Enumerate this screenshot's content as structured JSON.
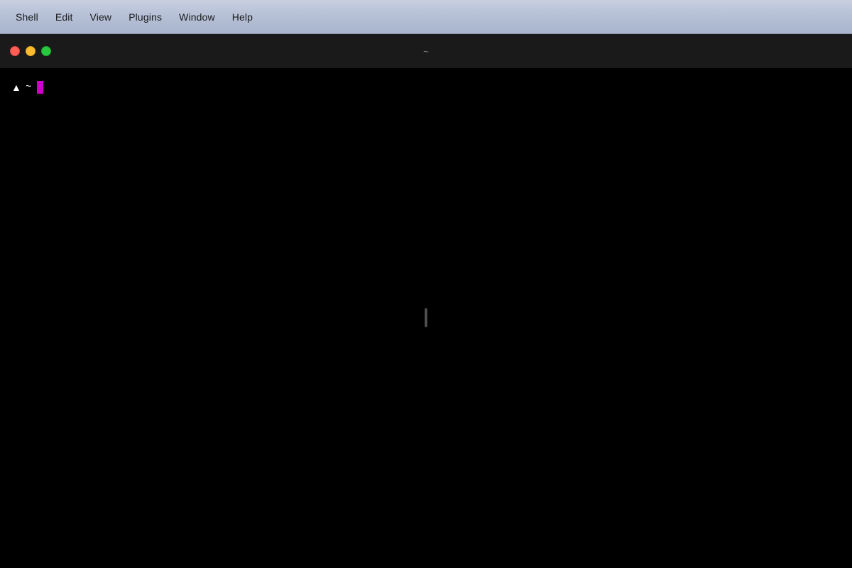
{
  "menubar": {
    "items": [
      {
        "label": "Shell",
        "id": "menu-shell"
      },
      {
        "label": "Edit",
        "id": "menu-edit"
      },
      {
        "label": "View",
        "id": "menu-view"
      },
      {
        "label": "Plugins",
        "id": "menu-plugins"
      },
      {
        "label": "Window",
        "id": "menu-window"
      },
      {
        "label": "Help",
        "id": "menu-help"
      }
    ]
  },
  "terminal": {
    "title": "~",
    "prompt_arrow": "▲",
    "prompt_tilde": "~",
    "cursor_color": "#cc00cc",
    "background": "#000000",
    "traffic_lights": {
      "close_color": "#ff5f57",
      "minimize_color": "#ffbd2e",
      "maximize_color": "#28c940"
    }
  }
}
